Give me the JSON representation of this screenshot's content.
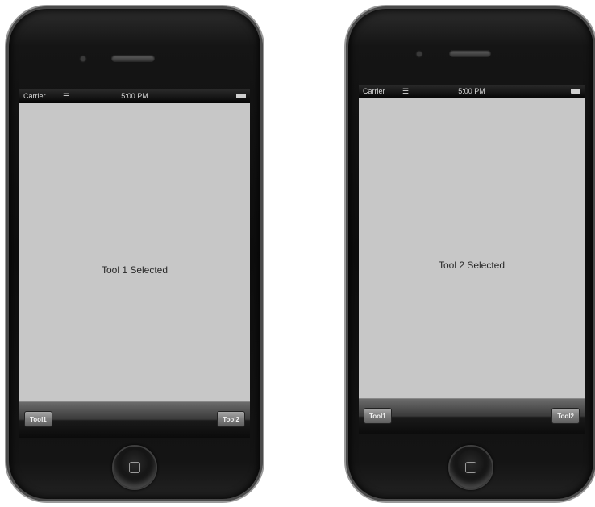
{
  "phones": {
    "left": {
      "status": {
        "carrier": "Carrier",
        "time": "5:00 PM",
        "wifi_icon": "wifi-icon",
        "battery_icon": "battery-icon"
      },
      "message": "Tool 1 Selected",
      "toolbar": {
        "tool1_label": "Tool1",
        "tool2_label": "Tool2"
      }
    },
    "right": {
      "status": {
        "carrier": "Carrier",
        "time": "5:00 PM",
        "wifi_icon": "wifi-icon",
        "battery_icon": "battery-icon"
      },
      "message": "Tool 2 Selected",
      "toolbar": {
        "tool1_label": "Tool1",
        "tool2_label": "Tool2"
      }
    }
  },
  "colors": {
    "content_background": "#c7c7c7",
    "phone_body": "#0d0d0d",
    "toolbar": "#1a1a1a"
  }
}
